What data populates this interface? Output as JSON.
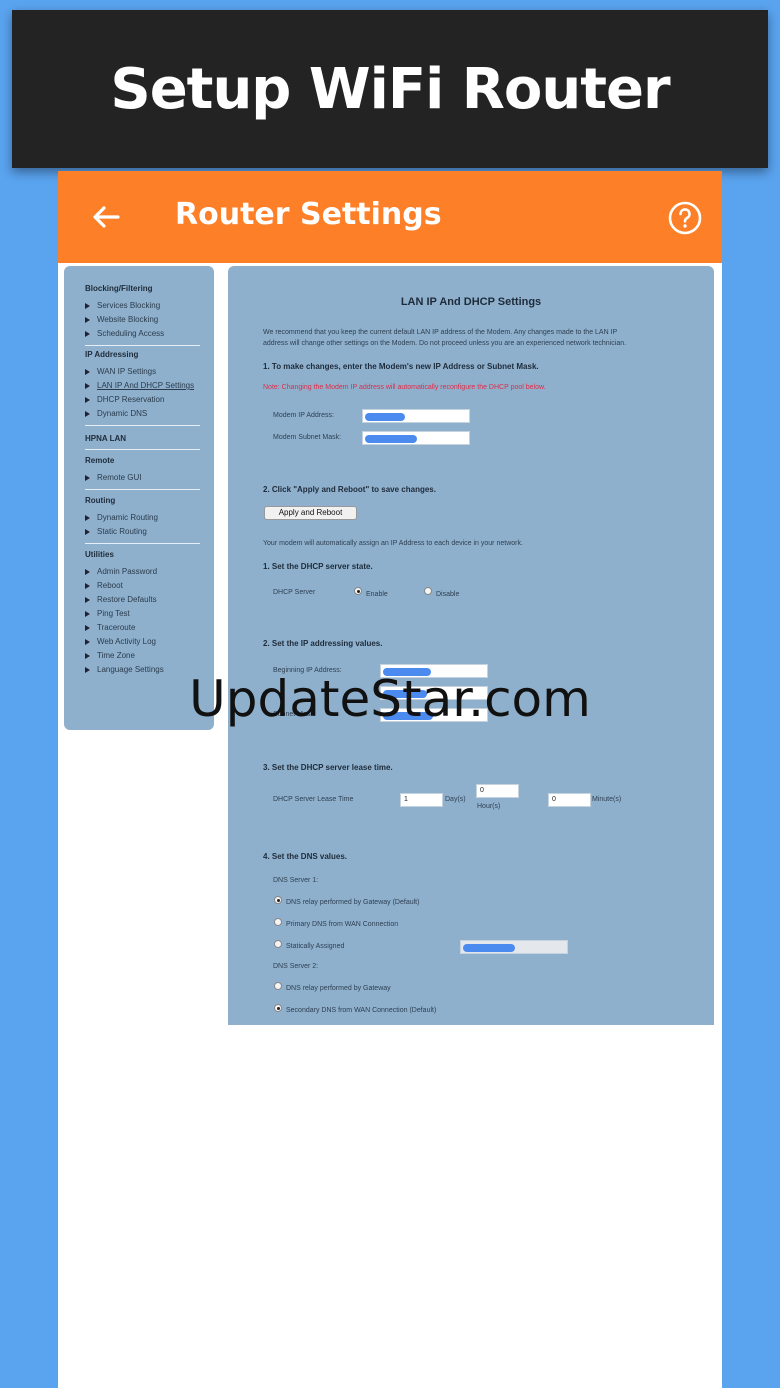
{
  "banner": {
    "title": "Setup WiFi Router"
  },
  "appbar": {
    "title": "Router Settings",
    "back_icon": "back-arrow-icon",
    "help_icon": "help-icon"
  },
  "sidebar": {
    "sections": [
      {
        "title": "Blocking/Filtering",
        "items": [
          "Services Blocking",
          "Website Blocking",
          "Scheduling Access"
        ]
      },
      {
        "title": "IP Addressing",
        "items": [
          "WAN IP Settings",
          "LAN IP And DHCP Settings",
          "DHCP Reservation",
          "Dynamic DNS"
        ]
      },
      {
        "title": "HPNA LAN",
        "items": []
      },
      {
        "title": "Remote",
        "items": [
          "Remote GUI"
        ]
      },
      {
        "title": "Routing",
        "items": [
          "Dynamic Routing",
          "Static Routing"
        ]
      },
      {
        "title": "Utilities",
        "items": [
          "Admin Password",
          "Reboot",
          "Restore Defaults",
          "Ping Test",
          "Traceroute",
          "Web Activity Log",
          "Time Zone",
          "Language Settings"
        ]
      }
    ],
    "active_item": "LAN IP And DHCP Settings"
  },
  "main": {
    "title": "LAN IP And DHCP Settings",
    "intro_1": "We recommend that you keep the current default LAN IP address of the Modem. Any changes made to the LAN IP",
    "intro_2": "address will change other settings on the Modem. Do not proceed unless you are an experienced network technician.",
    "step1": "1. To make changes, enter the Modem's new IP Address or Subnet Mask.",
    "note": "Note: Changing the Modem IP address will automatically reconfigure the DHCP pool below.",
    "modem_ip_label": "Modem IP Address:",
    "modem_subnet_label": "Modem Subnet Mask:",
    "step2": "2. Click \"Apply and Reboot\" to save changes.",
    "apply_button": "Apply and Reboot",
    "auto_assign": "Your modem will automatically assign an IP Address to each device in your network.",
    "dhcp_state_heading": "1. Set the DHCP server state.",
    "dhcp_server_label": "DHCP Server",
    "enable_label": "Enable",
    "disable_label": "Disable",
    "ip_values_heading": "2. Set the IP addressing values.",
    "beginning_ip_label": "Beginning IP Address:",
    "subnet_label": "Subnet Mask:",
    "lease_heading": "3. Set the DHCP server lease time.",
    "lease_label": "DHCP Server Lease Time",
    "lease_days": "1",
    "days_label": "Day(s)",
    "lease_hours": "0",
    "hours_label": "Hour(s)",
    "lease_minutes": "0",
    "minutes_label": "Minute(s)",
    "dns_heading": "4. Set the DNS values.",
    "dns1_label": "DNS Server 1:",
    "dns1_opt1": "DNS relay performed by Gateway (Default)",
    "dns1_opt2": "Primary DNS from WAN Connection",
    "dns1_opt3": "Statically Assigned",
    "dns2_label": "DNS Server 2:",
    "dns2_opt1": "DNS relay performed by Gateway",
    "dns2_opt2": "Secondary DNS from WAN Connection (Default)"
  },
  "watermark": "UpdateStar.com",
  "colors": {
    "background": "#5aa3ef",
    "banner": "#232323",
    "appbar": "#fd7f27",
    "panel": "#8fb0cc"
  }
}
